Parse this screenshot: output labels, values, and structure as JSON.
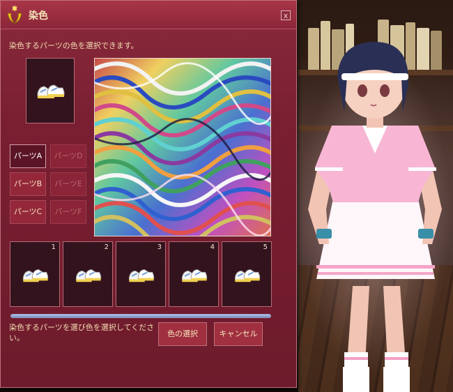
{
  "window": {
    "title": "染色",
    "close_label": "x",
    "instruction": "染色するパーツの色を選択できます。"
  },
  "parts": [
    {
      "label": "パーツA",
      "state": "selected"
    },
    {
      "label": "パーツD",
      "state": "disabled"
    },
    {
      "label": "パーツB",
      "state": "normal"
    },
    {
      "label": "パーツE",
      "state": "disabled"
    },
    {
      "label": "パーツC",
      "state": "normal"
    },
    {
      "label": "パーツF",
      "state": "disabled"
    }
  ],
  "slots": [
    {
      "number": "1",
      "icon": "sneaker-icon"
    },
    {
      "number": "2",
      "icon": "sneaker-icon"
    },
    {
      "number": "3",
      "icon": "sneaker-icon"
    },
    {
      "number": "4",
      "icon": "sneaker-icon"
    },
    {
      "number": "5",
      "icon": "sneaker-icon"
    }
  ],
  "progress": {
    "fraction": 1.0
  },
  "status_text": "染色するパーツを選び色を選択してください。",
  "buttons": {
    "select_color": "色の選択",
    "cancel": "キャンセル"
  },
  "colors": {
    "window_bg": "#7a1f32",
    "title_text": "#f4e6b8",
    "button_bg": "#a0303f"
  }
}
